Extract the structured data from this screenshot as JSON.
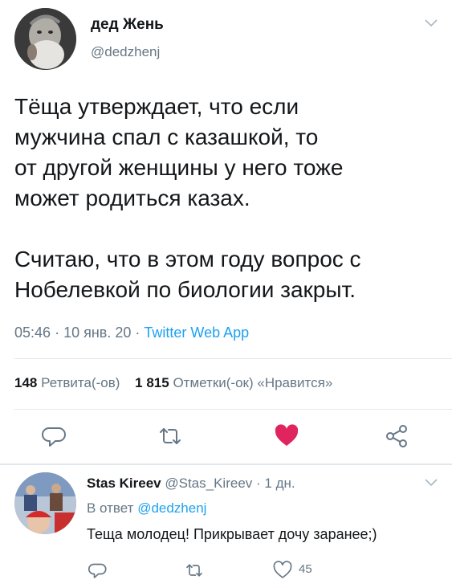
{
  "tweet": {
    "author": {
      "display_name": "дед Жень",
      "handle": "@dedzhenj"
    },
    "text": {
      "paragraph1": [
        "Тёща утверждает, что если",
        "мужчина спал с казашкой, то",
        "от другой женщины у него тоже",
        "может родиться казах."
      ],
      "paragraph2": [
        "Считаю, что в этом году вопрос с",
        "Нобелевкой по биологии закрыт."
      ]
    },
    "meta": {
      "time": "05:46",
      "date": "10 янв. 20",
      "separator": "·",
      "app": "Twitter Web App"
    },
    "stats": {
      "retweets_count": "148",
      "retweets_label": "Ретвита(-ов)",
      "likes_count": "1 815",
      "likes_label": "Отметки(-ок) «Нравится»"
    },
    "actions": {
      "reply_icon": "reply-icon",
      "retweet_icon": "retweet-icon",
      "like_icon": "heart-filled-icon",
      "share_icon": "share-icon",
      "like_color": "#e0245e"
    }
  },
  "reply": {
    "author": {
      "display_name": "Stas Kireev",
      "handle": "@Stas_Kireev",
      "separator": "·",
      "time": "1 дн."
    },
    "in_reply_prefix": "В ответ",
    "in_reply_mention": "@dedzhenj",
    "text": "Теща молодец! Прикрывает дочу заранее;)",
    "likes_count": "45"
  },
  "colors": {
    "text": "#14171a",
    "secondary": "#657786",
    "link": "#1da1f2",
    "like": "#e0245e",
    "divider": "#e1e8ed"
  }
}
